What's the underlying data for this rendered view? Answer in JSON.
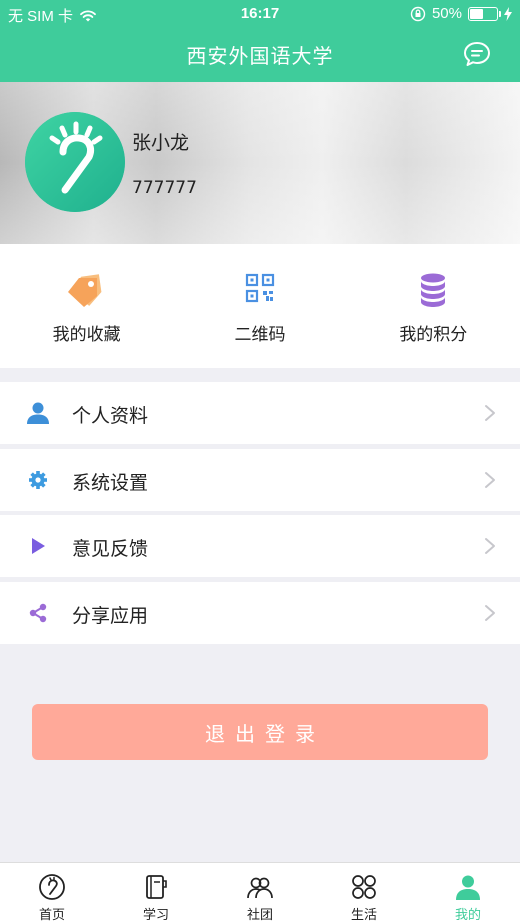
{
  "status_bar": {
    "carrier": "无 SIM 卡",
    "time": "16:17",
    "battery": "50%",
    "battery_level": 0.5
  },
  "navbar": {
    "title": "西安外国语大学",
    "message_icon": "chat-bubble-icon"
  },
  "profile": {
    "name": "张小龙",
    "user_id": "777777",
    "avatar_icon": "app-logo-icon"
  },
  "quick_actions": [
    {
      "label": "我的收藏",
      "icon": "tag-icon",
      "color": "#f6a35a"
    },
    {
      "label": "二维码",
      "icon": "qr-code-icon",
      "color": "#4a90e2"
    },
    {
      "label": "我的积分",
      "icon": "coin-stack-icon",
      "color": "#9b6bd6"
    }
  ],
  "menu": [
    {
      "label": "个人资料",
      "icon": "person-icon",
      "color": "#3d8fd8"
    },
    {
      "label": "系统设置",
      "icon": "gear-icon",
      "color": "#3d9be0"
    },
    {
      "label": "意见反馈",
      "icon": "play-icon",
      "color": "#7a5de0"
    },
    {
      "label": "分享应用",
      "icon": "share-icon",
      "color": "#9b6bd6"
    }
  ],
  "logout_label": "退出登录",
  "tabs": [
    {
      "label": "首页",
      "icon": "home-logo-icon"
    },
    {
      "label": "学习",
      "icon": "book-icon"
    },
    {
      "label": "社团",
      "icon": "group-icon"
    },
    {
      "label": "生活",
      "icon": "grid-icon"
    },
    {
      "label": "我的",
      "icon": "profile-icon",
      "active": true
    }
  ],
  "colors": {
    "primary": "#3fcc9b",
    "logout": "#ffa999",
    "background": "#efeff4"
  }
}
